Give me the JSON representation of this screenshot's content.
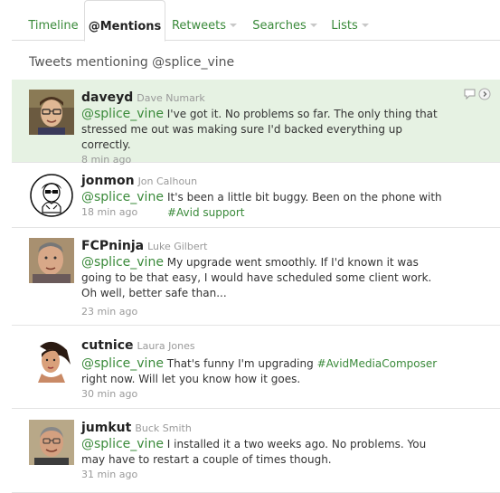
{
  "tabs": [
    {
      "label": "Timeline"
    },
    {
      "label": "@Mentions"
    },
    {
      "label": "Retweets"
    },
    {
      "label": "Searches"
    },
    {
      "label": "Lists"
    }
  ],
  "subtitle": "Tweets mentioning @splice_vine",
  "tweets": [
    {
      "username": "daveyd",
      "realname": "Dave Numark",
      "mention": "@splice_vine",
      "text": "I've got it.  No problems so far.  The only thing that stressed me out was making sure I'd backed everything up correctly.",
      "time": "8 min ago"
    },
    {
      "username": "jonmon",
      "realname": "Jon Calhoun",
      "mention": "@splice_vine",
      "text": "It's been a little bit buggy.  Been on the phone with",
      "hashtag": "#Avid support",
      "time": "18 min ago"
    },
    {
      "username": "FCPninja",
      "realname": "Luke Gilbert",
      "mention": "@splice_vine",
      "text": "My upgrade went smoothly.  If I'd known it was going to be that easy, I would have scheduled some client work.  Oh well, better safe than...",
      "time": "23 min ago"
    },
    {
      "username": "cutnice",
      "realname": "Laura Jones",
      "mention": "@splice_vine",
      "text_before": "That's funny I'm upgrading",
      "hashtag": "#AvidMediaComposer",
      "text_after": "right now.  Will let you know how it goes.",
      "time": "30 min ago"
    },
    {
      "username": "jumkut",
      "realname": "Buck Smith",
      "mention": "@splice_vine",
      "text": "I installed it a two weeks ago.  No problems. You may have to restart a couple of times though.",
      "time": "31 min ago"
    }
  ],
  "colors": {
    "accent": "#3a8a3a",
    "highlight_bg": "#e6f2e3"
  }
}
